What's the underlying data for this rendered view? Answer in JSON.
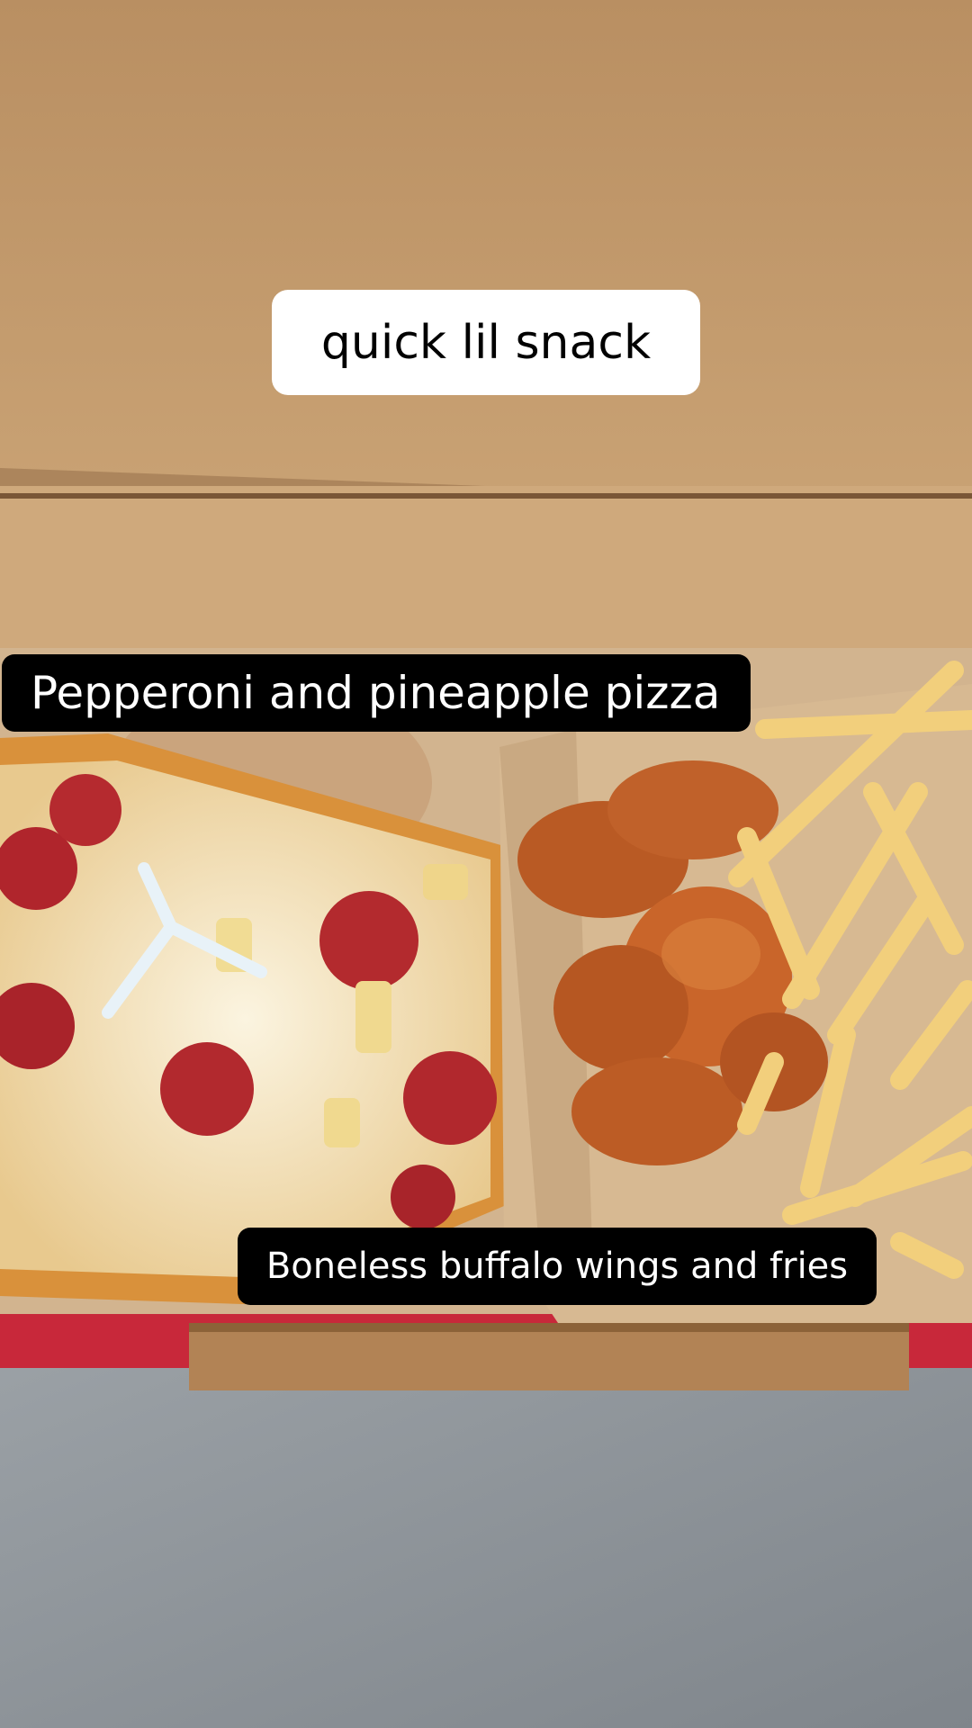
{
  "captions": {
    "top": "quick lil snack",
    "pizza": "Pepperoni and pineapple pizza",
    "wings": "Boneless buffalo wings and fries"
  },
  "colors": {
    "cardboard": "#c49a6c",
    "cardboard_dark": "#a87e52",
    "box_red": "#c8283a",
    "carpet": "#8f9499",
    "caption_dark": "#000000",
    "caption_light": "#ffffff"
  }
}
